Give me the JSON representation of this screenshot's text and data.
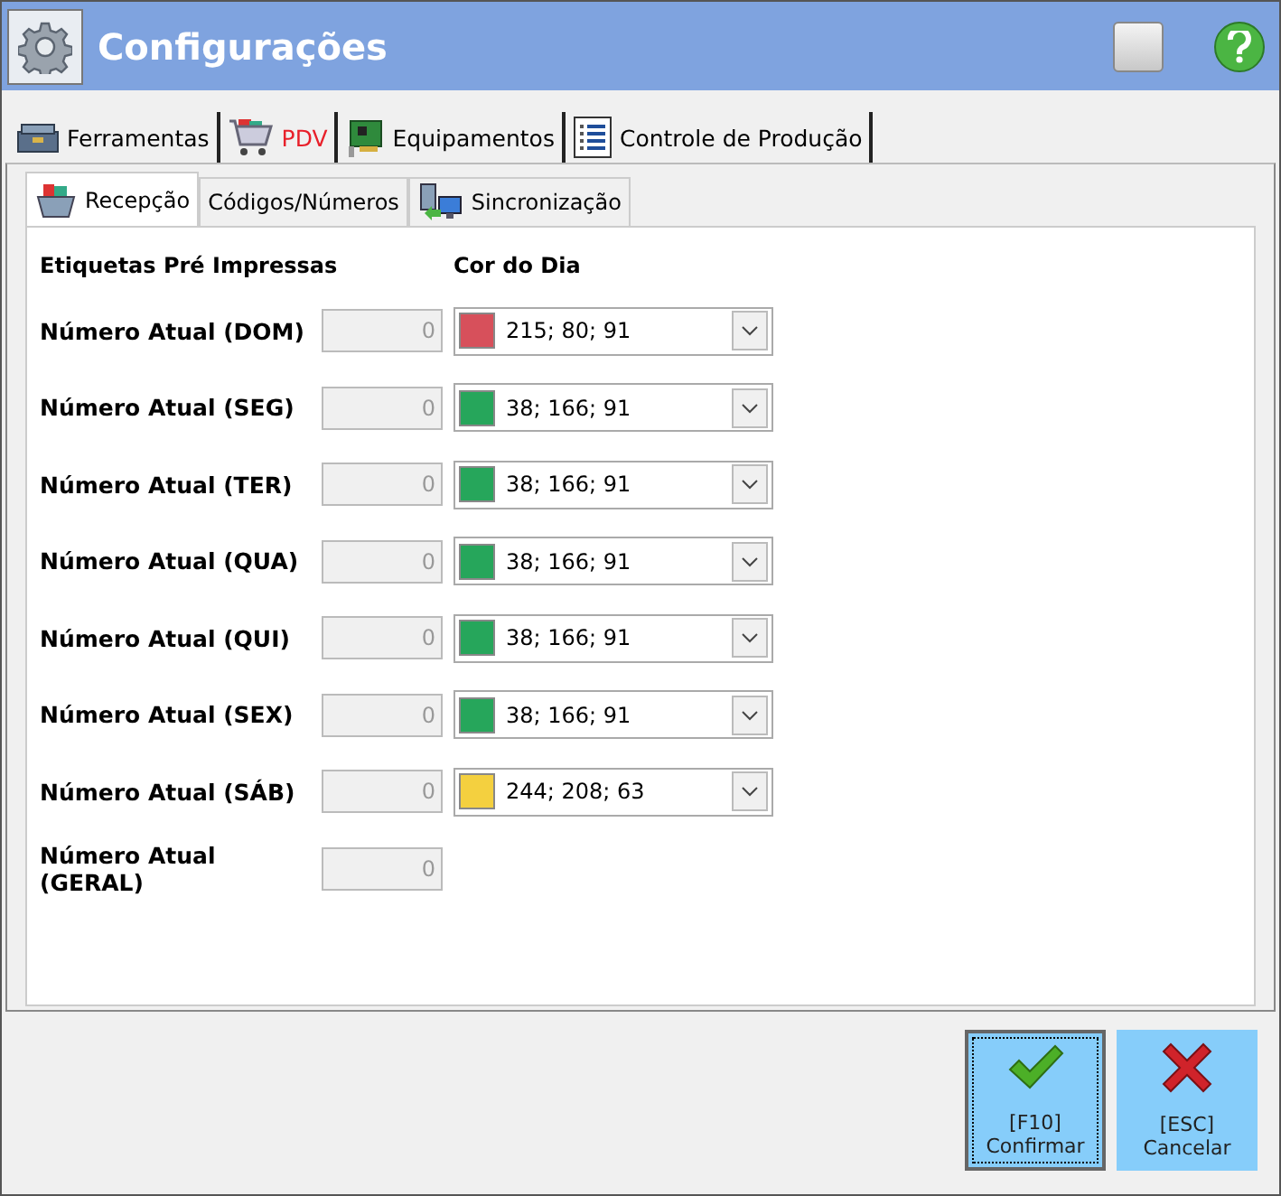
{
  "window": {
    "title": "Configurações"
  },
  "main_tabs": [
    {
      "label": "Ferramentas",
      "selected": false,
      "kind": "toolbox"
    },
    {
      "label": "PDV",
      "selected": true,
      "kind": "cart"
    },
    {
      "label": "Equipamentos",
      "selected": false,
      "kind": "board"
    },
    {
      "label": "Controle de Produção",
      "selected": false,
      "kind": "list"
    }
  ],
  "sub_tabs": [
    {
      "label": "Recepção",
      "selected": true,
      "kind": "basket"
    },
    {
      "label": "Códigos/Números",
      "selected": false,
      "kind": "none"
    },
    {
      "label": "Sincronização",
      "selected": false,
      "kind": "sync"
    }
  ],
  "headers": {
    "column_1": "Etiquetas Pré Impressas",
    "column_2": "Cor do Dia"
  },
  "rows": [
    {
      "label": "Número Atual (DOM)",
      "value": "0",
      "disabled": true,
      "color_text": "215; 80; 91",
      "color": "#d7505b"
    },
    {
      "label": "Número Atual (SEG)",
      "value": "0",
      "disabled": true,
      "color_text": "38; 166; 91",
      "color": "#26a65b"
    },
    {
      "label": "Número Atual (TER)",
      "value": "0",
      "disabled": true,
      "color_text": "38; 166; 91",
      "color": "#26a65b"
    },
    {
      "label": "Número Atual (QUA)",
      "value": "0",
      "disabled": true,
      "color_text": "38; 166; 91",
      "color": "#26a65b"
    },
    {
      "label": "Número Atual (QUI)",
      "value": "0",
      "disabled": true,
      "color_text": "38; 166; 91",
      "color": "#26a65b"
    },
    {
      "label": "Número Atual (SEX)",
      "value": "0",
      "disabled": true,
      "color_text": "38; 166; 91",
      "color": "#26a65b"
    },
    {
      "label": "Número Atual (SÁB)",
      "value": "0",
      "disabled": true,
      "color_text": "244; 208; 63",
      "color": "#f4d03f"
    },
    {
      "label": "Número Atual (GERAL)",
      "value": "0",
      "disabled": true
    }
  ],
  "buttons": [
    {
      "key": "[F10]",
      "label": "Confirmar",
      "kind": "confirm",
      "focused": true
    },
    {
      "key": "[ESC]",
      "label": "Cancelar",
      "kind": "cancel",
      "focused": false
    }
  ]
}
